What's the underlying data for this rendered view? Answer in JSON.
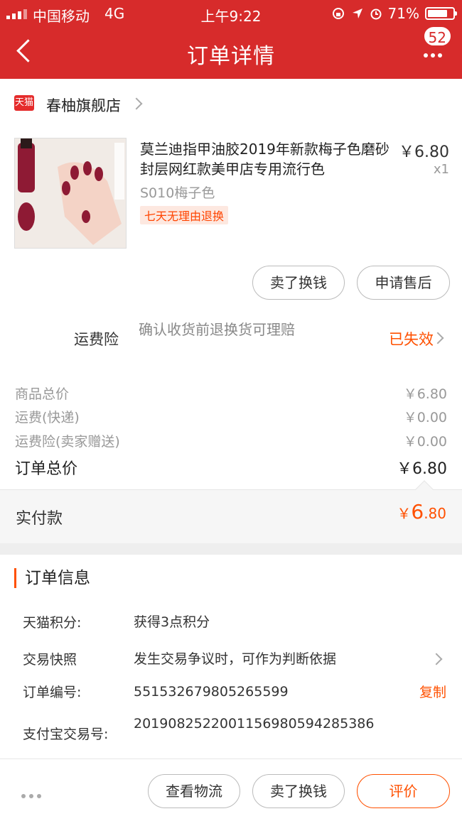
{
  "status_bar": {
    "carrier": "中国移动",
    "network": "4G",
    "time": "上午9:22",
    "battery": "71%"
  },
  "nav": {
    "title": "订单详情",
    "badge": "52"
  },
  "store": {
    "logo": "天猫",
    "name": "春柚旗舰店"
  },
  "product": {
    "title": "莫兰迪指甲油胶2019年新款梅子色磨砂封层网红款美甲店专用流行色",
    "price": "￥6.80",
    "qty": "x1",
    "sku": "S010梅子色",
    "tag": "七天无理由退换",
    "actions": [
      "卖了换钱",
      "申请售后"
    ]
  },
  "insurance": {
    "label": "运费险",
    "desc": "确认收货前退换货可理赔",
    "status": "已失效"
  },
  "summary": [
    {
      "label": "商品总价",
      "value": "￥6.80"
    },
    {
      "label": "运费(快递)",
      "value": "￥0.00"
    },
    {
      "label": "运费险(卖家赠送)",
      "value": "￥0.00"
    }
  ],
  "order_total": {
    "label": "订单总价",
    "value": "￥6.80"
  },
  "paid": {
    "label": "实付款",
    "currency": "￥",
    "integer": "6",
    "decimal": ".80"
  },
  "order_info": {
    "title": "订单信息",
    "rows": [
      {
        "key": "天猫积分:",
        "value": "获得3点积分"
      },
      {
        "key": "交易快照",
        "value": "发生交易争议时，可作为判断依据"
      },
      {
        "key": "订单编号:",
        "value": "551532679805265599"
      },
      {
        "key": "支付宝交易号:",
        "value": "2019082522001156980594285386"
      }
    ],
    "copy_label": "复制"
  },
  "bottom_bar": {
    "buttons": [
      "查看物流",
      "卖了换钱",
      "评价"
    ]
  },
  "colors": {
    "brand_red": "#d72b2b",
    "accent_orange": "#ff5000"
  }
}
